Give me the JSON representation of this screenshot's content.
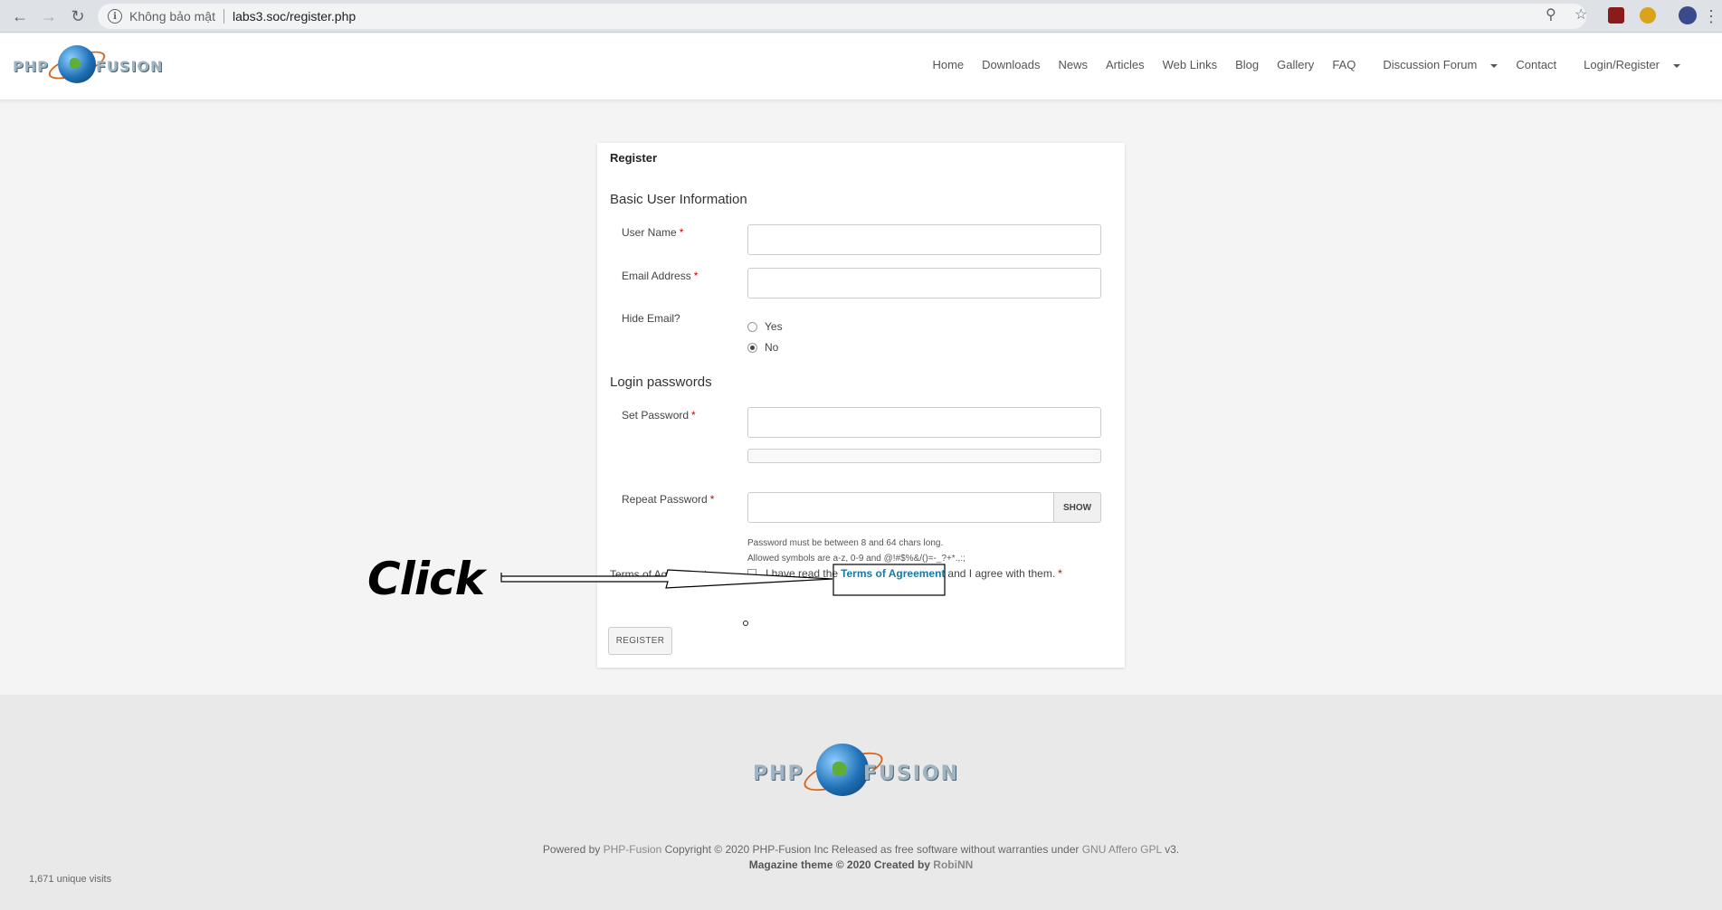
{
  "browser": {
    "security_label": "Không bảo mật",
    "url": "labs3.soc/register.php"
  },
  "header": {
    "logo_left": "PHP",
    "logo_right": "FUSION",
    "nav": [
      "Home",
      "Downloads",
      "News",
      "Articles",
      "Web Links",
      "Blog",
      "Gallery",
      "FAQ",
      "Discussion Forum",
      "Contact",
      "Login/Register"
    ]
  },
  "form": {
    "title": "Register",
    "section_basic": "Basic User Information",
    "username_label": "User Name",
    "email_label": "Email Address",
    "hide_email_label": "Hide Email?",
    "hide_yes": "Yes",
    "hide_no": "No",
    "section_login": "Login passwords",
    "set_password_label": "Set Password",
    "repeat_password_label": "Repeat Password",
    "show_button": "SHOW",
    "hint_length": "Password must be between 8 and 64 chars long.",
    "hint_symbols": "Allowed symbols are a-z, 0-9 and @!#$%&/()=-_?+*.,:;",
    "terms_label": "Terms of Agreement",
    "terms_prefix": "I have read the",
    "terms_link": "Terms of Agreement",
    "terms_suffix": "and I agree with them.",
    "required_mark": "*",
    "register_button": "REGISTER"
  },
  "annotation": {
    "label": "Click"
  },
  "footer": {
    "powered_by": "Powered by",
    "php_fusion_link": "PHP-Fusion",
    "copyright": "Copyright © 2020 PHP-Fusion Inc Released as free software without warranties under",
    "license_link": "GNU Affero GPL",
    "license_suffix": "v3.",
    "theme_credit": "Magazine theme © 2020 Created by",
    "theme_author": "RobiNN",
    "visits": "1,671 unique visits"
  }
}
